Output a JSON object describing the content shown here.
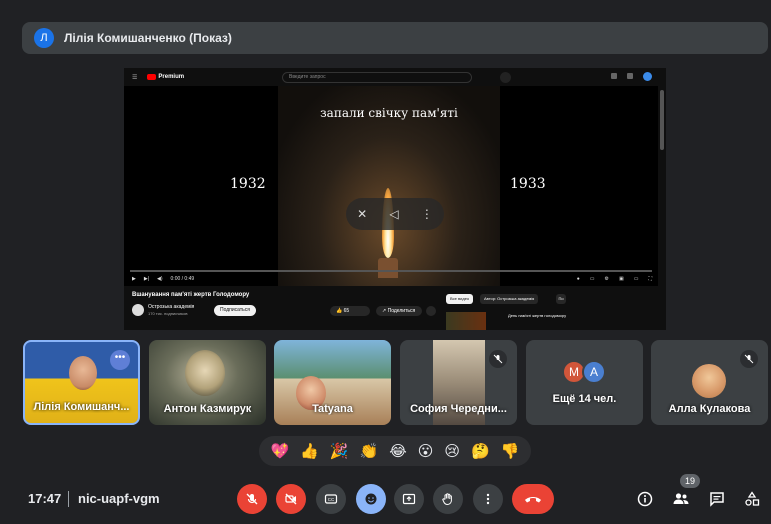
{
  "presenter": {
    "initial": "Л",
    "title": "Лілія Комишанченко (Показ)"
  },
  "youtube": {
    "brand": "Premium",
    "search_placeholder": "Введите запрос",
    "video_caption": "запали свічку пам'яті",
    "year_left": "1932",
    "year_right": "1933",
    "time_display": "0:00 / 0:49",
    "video_title": "Вшанування пам'яті жертв Голодомору",
    "channel_name": "Острозька академія",
    "channel_subs": "170 тис. подписчиков",
    "subscribe_label": "Подписаться",
    "likes": "65",
    "share_label": "Поделиться",
    "chip_all": "Все видео",
    "chip_author": "Автор: Острозька академія",
    "chip_more": "По",
    "rec_title": "День пам'яті жертв голодомору"
  },
  "participants": [
    {
      "name": "Лілія Комишанч...",
      "muted": false
    },
    {
      "name": "Антон Казмирук",
      "muted": false
    },
    {
      "name": "Tatyana",
      "muted": false
    },
    {
      "name": "София Чередни...",
      "muted": true
    },
    {
      "name": "Ещё 14 чел.",
      "avatars": [
        "М",
        "А"
      ],
      "avatar_colors": [
        "#d1563a",
        "#4a7fd0"
      ]
    },
    {
      "name": "Алла Кулакова",
      "muted": true
    }
  ],
  "reactions": [
    "💖",
    "👍",
    "🎉",
    "👏",
    "😂",
    "😮",
    "😢",
    "🤔",
    "👎"
  ],
  "bottom": {
    "time": "17:47",
    "meeting_code": "nic-uapf-vgm",
    "people_count": "19"
  },
  "colors": {
    "leave": "#ea4335",
    "accent": "#8ab4f8",
    "bar": "#3c4043"
  }
}
